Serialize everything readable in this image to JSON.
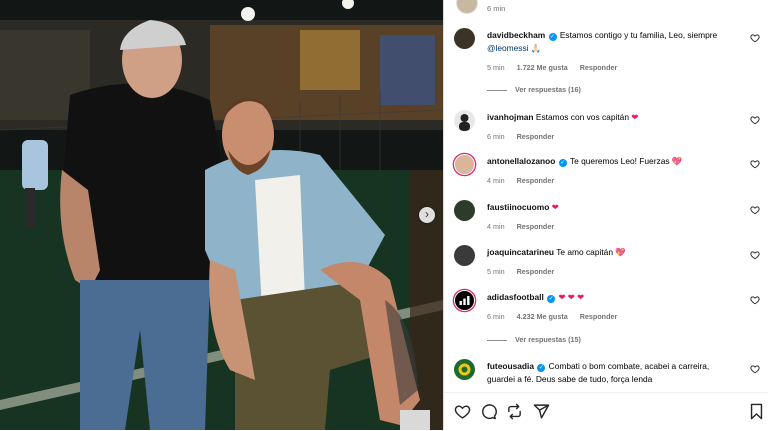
{
  "post": {
    "top_time": "6 min"
  },
  "comments": [
    {
      "user": "davidbeckham",
      "verified": true,
      "text": "Estamos contigo y tu familia, Leo, siempre ",
      "mention": "@leomessi",
      "emoji": "🙏🏻",
      "time": "5 min",
      "likes": "1.722 Me gusta",
      "reply": "Responder",
      "view_replies": "Ver respuestas (16)"
    },
    {
      "user": "ivanhojman",
      "verified": false,
      "text": "Estamos con vos capitán ",
      "emoji": "❤",
      "time": "6 min",
      "reply": "Responder"
    },
    {
      "user": "antonellalozanoo",
      "verified": true,
      "text": "Te queremos Leo! Fuerzas ",
      "emoji": "💖",
      "time": "4 min",
      "reply": "Responder"
    },
    {
      "user": "faustiinocuomo",
      "verified": false,
      "text": "",
      "emoji": "❤",
      "time": "4 min",
      "reply": "Responder"
    },
    {
      "user": "joaquincatarineu",
      "verified": false,
      "text": "Te amo capitán ",
      "emoji": "💖",
      "time": "5 min",
      "reply": "Responder"
    },
    {
      "user": "adidasfootball",
      "verified": true,
      "text": "",
      "emoji": "❤ ❤ ❤",
      "time": "6 min",
      "likes": "4.232 Me gusta",
      "reply": "Responder",
      "view_replies": "Ver respuestas (15)"
    },
    {
      "user": "futeousadia",
      "verified": true,
      "text": "Combati o bom combate, acabei a carreira, guardei a fé. Deus sabe de tudo, força lenda"
    }
  ],
  "icons": {
    "like": "heart-outline-icon",
    "comment": "comment-bubble-icon",
    "share": "paper-plane-icon",
    "save": "bookmark-icon",
    "carousel_next": "chevron-right-icon",
    "verified": "verified-badge-icon"
  },
  "colors": {
    "verified": "#0095f6",
    "heart": "#ed1965",
    "link": "#00376b",
    "secondary_text": "#737373"
  }
}
